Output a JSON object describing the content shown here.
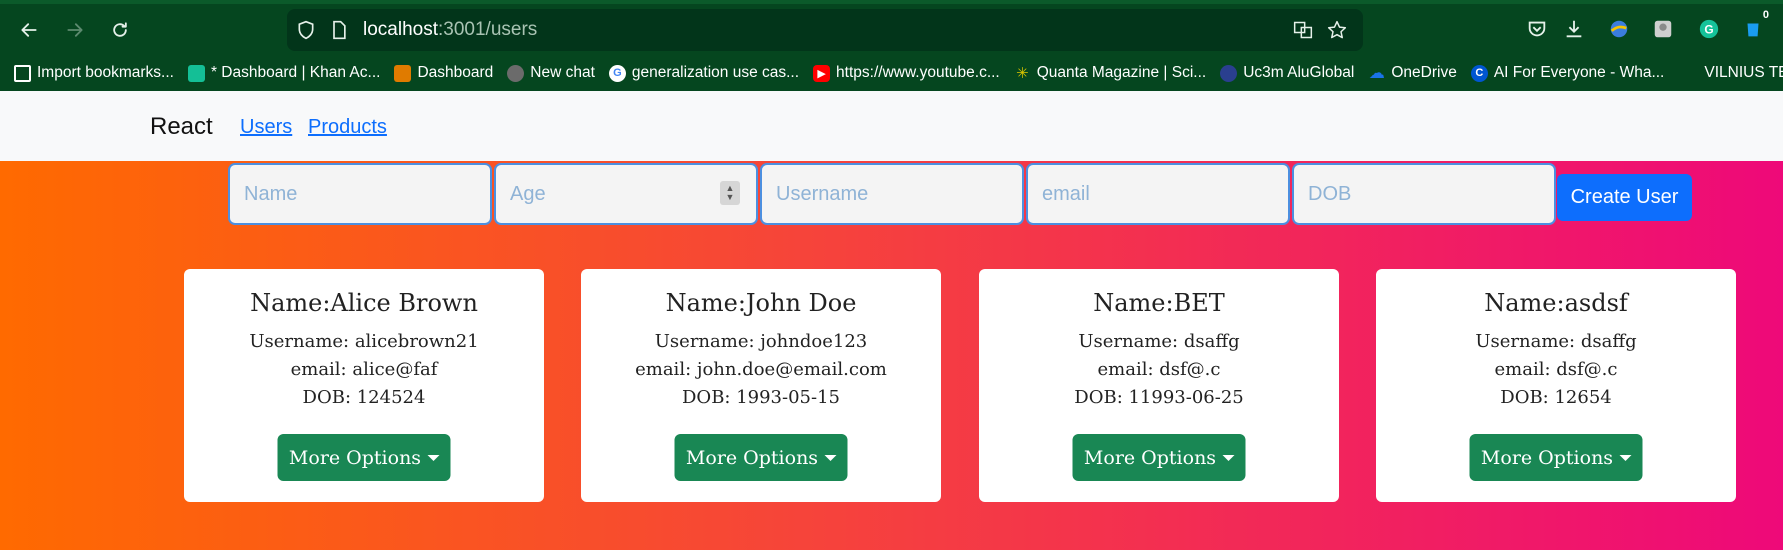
{
  "browser": {
    "url_host": "localhost",
    "url_path": ":3001/users",
    "downloads_badge": "0",
    "bookmarks": [
      {
        "label": "Import bookmarks...",
        "icon": "import-icon",
        "color": "#05461f"
      },
      {
        "label": "* Dashboard | Khan Ac...",
        "icon": "khan-academy-icon",
        "color": "#14bf96"
      },
      {
        "label": "Dashboard",
        "icon": "dashboard-icon",
        "color": "#e07b00"
      },
      {
        "label": "New chat",
        "icon": "chatgpt-icon",
        "color": "#6b6b6b"
      },
      {
        "label": "generalization use cas...",
        "icon": "google-icon",
        "color": "#ffffff"
      },
      {
        "label": "https://www.youtube.c...",
        "icon": "youtube-icon",
        "color": "#ff0000"
      },
      {
        "label": "Quanta Magazine | Sci...",
        "icon": "quanta-icon",
        "color": "#b5a000"
      },
      {
        "label": "Uc3m AluGlobal",
        "icon": "uc3m-icon",
        "color": "#2a3f8f"
      },
      {
        "label": "OneDrive",
        "icon": "onedrive-icon",
        "color": "#1a73e8"
      },
      {
        "label": "AI For Everyone - Wha...",
        "icon": "coursera-icon",
        "color": "#0056d2"
      },
      {
        "label": "VILNIUS TECH V",
        "icon": "",
        "color": ""
      }
    ]
  },
  "navbar": {
    "brand": "React",
    "links": [
      "Users",
      "Products"
    ]
  },
  "form": {
    "placeholders": {
      "name": "Name",
      "age": "Age",
      "username": "Username",
      "email": "email",
      "dob": "DOB"
    },
    "create_label": "Create User"
  },
  "users": [
    {
      "name": "Name:Alice Brown",
      "username": "Username: alicebrown21",
      "email": "email: alice@faf",
      "dob": "DOB: 124524",
      "button": "More Options"
    },
    {
      "name": "Name:John Doe",
      "username": "Username: johndoe123",
      "email": "email: john.doe@email.com",
      "dob": "DOB: 1993-05-15",
      "button": "More Options"
    },
    {
      "name": "Name:BET",
      "username": "Username: dsaffg",
      "email": "email: dsf@.c",
      "dob": "DOB: 11993-06-25",
      "button": "More Options"
    },
    {
      "name": "Name:asdsf",
      "username": "Username: dsaffg",
      "email": "email: dsf@.c",
      "dob": "DOB: 12654",
      "button": "More Options"
    }
  ],
  "colors": {
    "chrome_bg": "#05461f",
    "gradient_start": "#ff6a00",
    "gradient_end": "#ee0979",
    "primary": "#0d6efd",
    "success": "#198754"
  }
}
